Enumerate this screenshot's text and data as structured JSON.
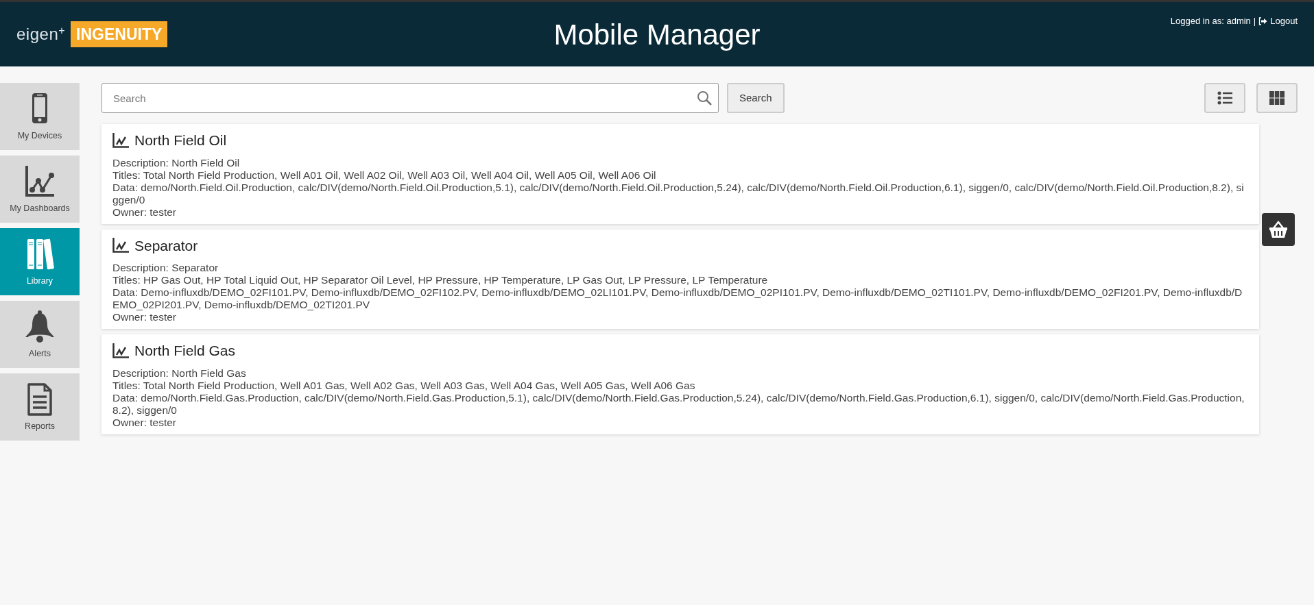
{
  "header": {
    "logo_text": "eigen",
    "logo_sup": "+",
    "logo_badge": "INGENUITY",
    "title": "Mobile Manager",
    "user_label": "Logged in as: admin",
    "separator": "|",
    "logout": "Logout"
  },
  "sidebar": {
    "items": [
      {
        "kind": "phone",
        "label": "My Devices",
        "selected": false
      },
      {
        "kind": "chart",
        "label": "My Dashboards",
        "selected": false
      },
      {
        "kind": "books",
        "label": "Library",
        "selected": true
      },
      {
        "kind": "bell",
        "label": "Alerts",
        "selected": false
      },
      {
        "kind": "document",
        "label": "Reports",
        "selected": false
      }
    ]
  },
  "search": {
    "placeholder": "Search",
    "button": "Search"
  },
  "view_toggles": [
    {
      "kind": "list",
      "selected": false
    },
    {
      "kind": "grid",
      "selected": false
    }
  ],
  "cards": [
    {
      "title": "North Field Oil",
      "lines": [
        "Description: North Field Oil",
        "Titles: Total North Field Production, Well A01 Oil, Well A02 Oil, Well A03 Oil, Well A04 Oil, Well A05 Oil, Well A06 Oil",
        "Data: demo/North.Field.Oil.Production, calc/DIV(demo/North.Field.Oil.Production,5.1), calc/DIV(demo/North.Field.Oil.Production,5.24), calc/DIV(demo/North.Field.Oil.Production,6.1), siggen/0, calc/DIV(demo/North.Field.Oil.Production,8.2), siggen/0",
        "Owner: tester"
      ]
    },
    {
      "title": "Separator",
      "lines": [
        "Description: Separator",
        "Titles: HP Gas Out, HP Total Liquid Out, HP Separator Oil Level, HP Pressure, HP Temperature, LP Gas Out, LP Pressure, LP Temperature",
        "Data: Demo-influxdb/DEMO_02FI101.PV, Demo-influxdb/DEMO_02FI102.PV, Demo-influxdb/DEMO_02LI101.PV, Demo-influxdb/DEMO_02PI101.PV, Demo-influxdb/DEMO_02TI101.PV, Demo-influxdb/DEMO_02FI201.PV, Demo-influxdb/DEMO_02PI201.PV, Demo-influxdb/DEMO_02TI201.PV",
        "Owner: tester"
      ]
    },
    {
      "title": "North Field Gas",
      "lines": [
        "Description: North Field Gas",
        "Titles: Total North Field Production, Well A01 Gas, Well A02 Gas, Well A03 Gas, Well A04 Gas, Well A05 Gas, Well A06 Gas",
        "Data: demo/North.Field.Gas.Production, calc/DIV(demo/North.Field.Gas.Production,5.1), calc/DIV(demo/North.Field.Gas.Production,5.24), calc/DIV(demo/North.Field.Gas.Production,6.1), siggen/0, calc/DIV(demo/North.Field.Gas.Production,8.2), siggen/0",
        "Owner: tester"
      ]
    }
  ]
}
